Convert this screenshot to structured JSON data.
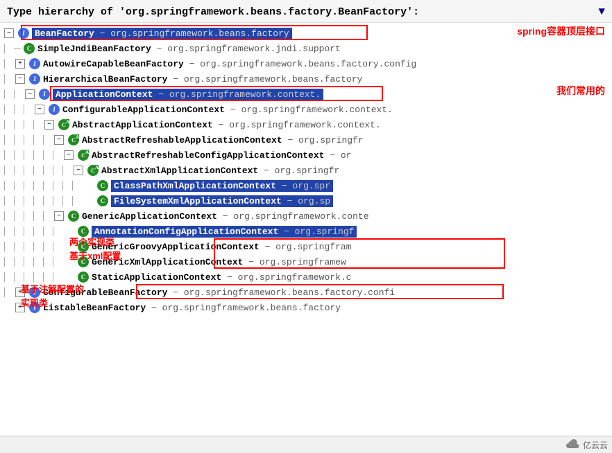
{
  "header": {
    "title": "Type hierarchy of 'org.springframework.beans.factory.BeanFactory':",
    "dropdown_icon": "▼"
  },
  "annotations": {
    "spring_container": "spring容器顶层接口",
    "commonly_used": "我们常用的",
    "xml_impl_line1": "两个实现类",
    "xml_impl_line2": "基于xml配置",
    "annotation_impl_line1": "基于注解配置的",
    "annotation_impl_line2": "实现类"
  },
  "watermark": "亿云云",
  "tree": [
    {
      "id": "bean-factory",
      "indent": 0,
      "expand": "-",
      "badge": "interface",
      "name": "BeanFactory",
      "package": "- org.springframework.beans.factory",
      "selected": true
    },
    {
      "id": "simple-jndi",
      "indent": 1,
      "expand": null,
      "badge": "class",
      "name": "SimpleJndiBeanFactory",
      "package": "- org.springframework.jndi.support",
      "selected": false
    },
    {
      "id": "autowire-capable",
      "indent": 1,
      "expand": "+",
      "badge": "interface",
      "name": "AutowireCapableBeanFactory",
      "package": "- org.springframework.beans.factory.config",
      "selected": false
    },
    {
      "id": "hierarchical",
      "indent": 1,
      "expand": "-",
      "badge": "interface",
      "name": "HierarchicalBeanFactory",
      "package": "- org.springframework.beans.factory",
      "selected": false
    },
    {
      "id": "application-context",
      "indent": 2,
      "expand": "-",
      "badge": "interface",
      "name": "ApplicationContext",
      "package": "- org.springframework.context.",
      "selected": false,
      "highlight": true
    },
    {
      "id": "configurable-app-context",
      "indent": 3,
      "expand": "-",
      "badge": "interface",
      "name": "ConfigurableApplicationContext",
      "package": "- org.springframework.context.",
      "selected": false
    },
    {
      "id": "abstract-app-context",
      "indent": 4,
      "expand": "-",
      "badge": "abstract",
      "name": "AbstractApplicationContext",
      "package": "- org.springframework.context.",
      "selected": false
    },
    {
      "id": "abstract-refreshable",
      "indent": 5,
      "expand": "-",
      "badge": "abstract",
      "name": "AbstractRefreshableApplicationContext",
      "package": "- org.springfr",
      "selected": false
    },
    {
      "id": "abstract-refreshable-config",
      "indent": 6,
      "expand": "-",
      "badge": "abstract",
      "name": "AbstractRefreshableConfigApplicationContext",
      "package": "- or",
      "selected": false
    },
    {
      "id": "abstract-xml",
      "indent": 7,
      "expand": "-",
      "badge": "abstract",
      "name": "AbstractXmlApplicationContext",
      "package": "- org.springfr",
      "selected": false
    },
    {
      "id": "classpath-xml",
      "indent": 8,
      "expand": null,
      "badge": "class",
      "name": "ClassPathXmlApplicationContext",
      "package": "- org.spr",
      "selected": false,
      "highlight": true
    },
    {
      "id": "filesystem-xml",
      "indent": 8,
      "expand": null,
      "badge": "class",
      "name": "FileSystemXmlApplicationContext",
      "package": "- org.sp",
      "selected": false,
      "highlight": true
    },
    {
      "id": "generic-app-context",
      "indent": 4,
      "expand": "-",
      "badge": "class",
      "name": "GenericApplicationContext",
      "package": "- org.springframework.conte",
      "selected": false
    },
    {
      "id": "annotation-config",
      "indent": 5,
      "expand": null,
      "badge": "class",
      "name": "AnnotationConfigApplicationContext",
      "package": "- org.springf",
      "selected": false,
      "highlight": true
    },
    {
      "id": "generic-groovy",
      "indent": 5,
      "expand": null,
      "badge": "class",
      "name": "GenericGroovyApplicationContext",
      "package": "- org.springfram",
      "selected": false
    },
    {
      "id": "generic-xml",
      "indent": 5,
      "expand": null,
      "badge": "class",
      "name": "GenericXmlApplicationContext",
      "package": "- org.springframew",
      "selected": false
    },
    {
      "id": "static-app-context",
      "indent": 5,
      "expand": null,
      "badge": "class",
      "name": "StaticApplicationContext",
      "package": "- org.springframework.c",
      "selected": false
    },
    {
      "id": "configurable-bean-factory",
      "indent": 1,
      "expand": "+",
      "badge": "interface",
      "name": "ConfigurableBeanFactory",
      "package": "- org.springframework.beans.factory.confi",
      "selected": false
    },
    {
      "id": "listable-bean-factory",
      "indent": 1,
      "expand": "+",
      "badge": "interface",
      "name": "ListableBeanFactory",
      "package": "- org.springframework.beans.factory",
      "selected": false
    }
  ]
}
